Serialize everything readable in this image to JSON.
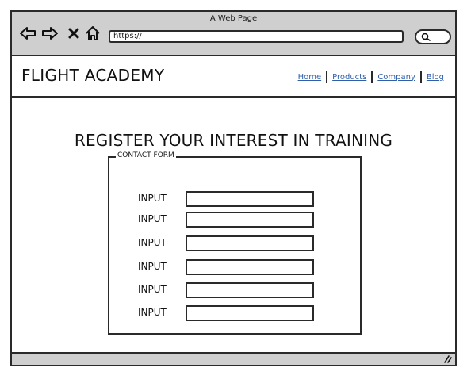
{
  "window": {
    "title": "A Web Page",
    "url": "https://"
  },
  "toolbar": {
    "icons": [
      "back-arrow-icon",
      "forward-arrow-icon",
      "close-icon",
      "home-icon",
      "search-icon"
    ]
  },
  "header": {
    "site_title": "FLIGHT ACADEMY",
    "nav": [
      {
        "label": "Home"
      },
      {
        "label": "Products"
      },
      {
        "label": "Company"
      },
      {
        "label": "Blog"
      }
    ]
  },
  "main": {
    "heading": "REGISTER YOUR INTEREST IN TRAINING",
    "form": {
      "legend": "CONTACT FORM",
      "fields": [
        {
          "label": "INPUT",
          "value": ""
        },
        {
          "label": "INPUT",
          "value": ""
        },
        {
          "label": "INPUT",
          "value": ""
        },
        {
          "label": "INPUT",
          "value": ""
        },
        {
          "label": "INPUT",
          "value": ""
        },
        {
          "label": "INPUT",
          "value": ""
        }
      ]
    }
  },
  "colors": {
    "chrome": "#cfcfcf",
    "border": "#2a2a2a",
    "link": "#2e5fa8"
  }
}
